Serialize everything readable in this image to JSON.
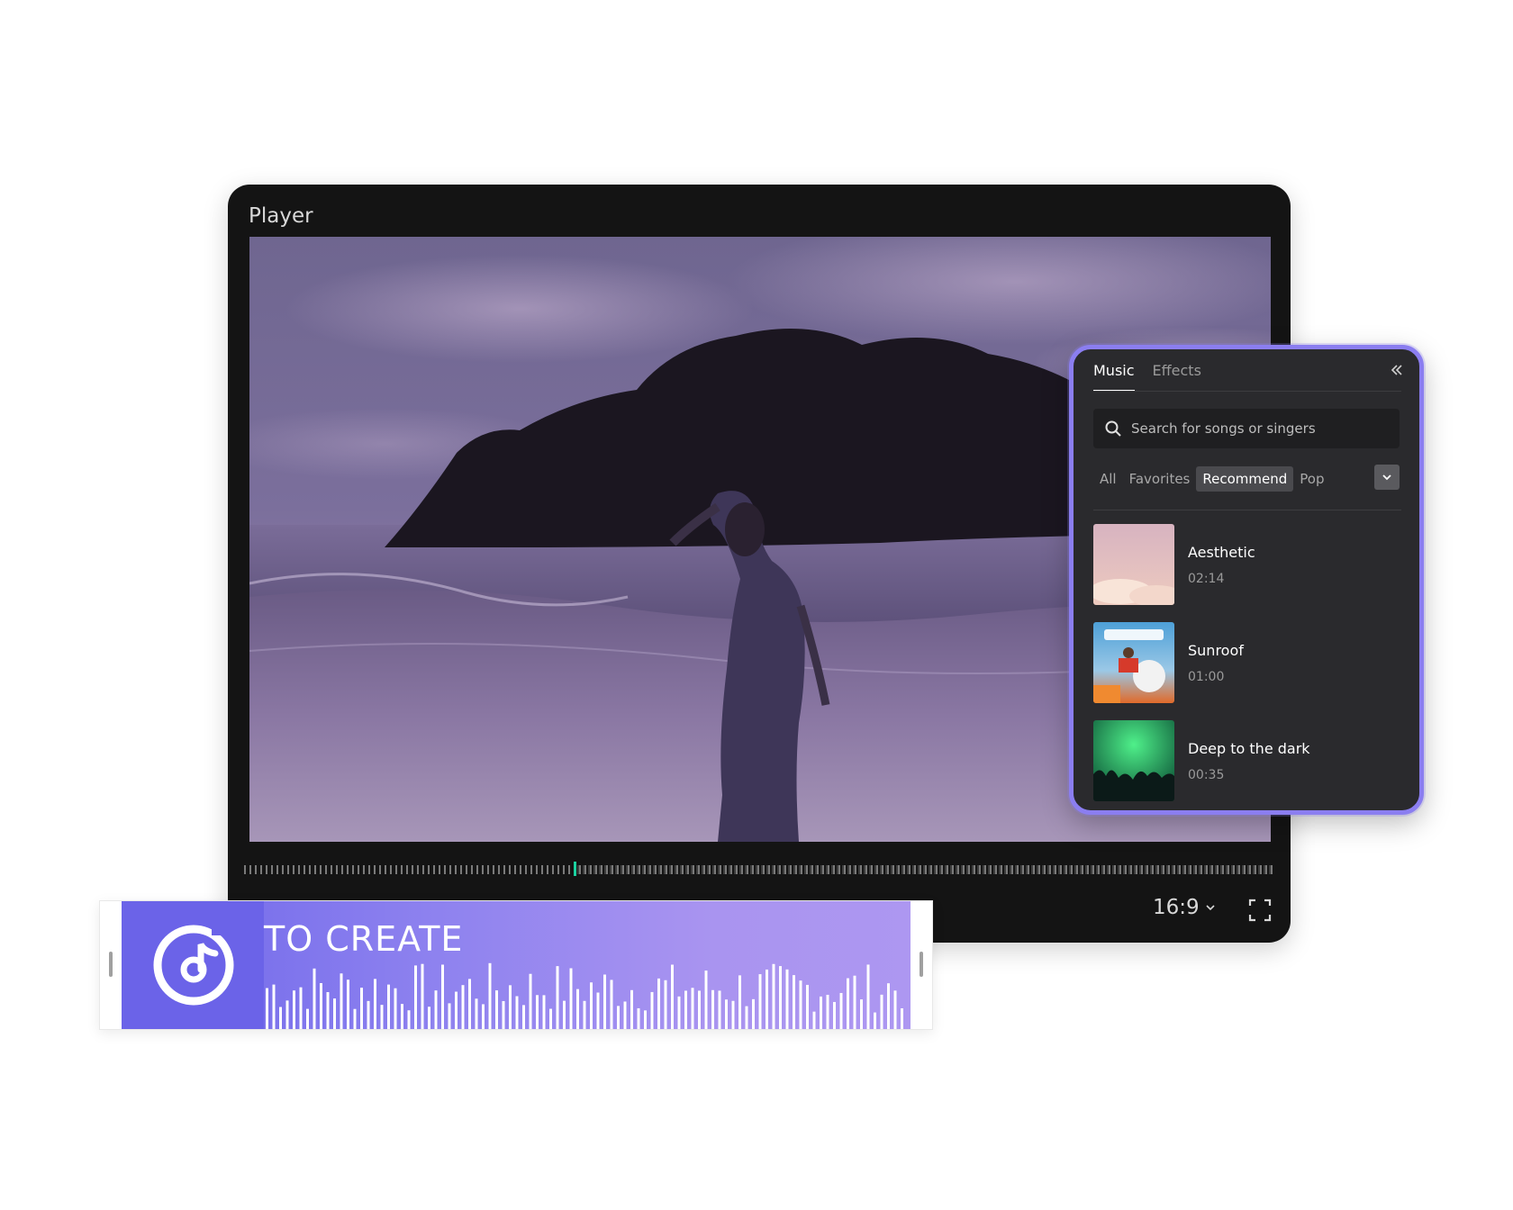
{
  "player": {
    "title": "Player",
    "playhead_progress": 0.32,
    "aspect_ratio": "16:9"
  },
  "music_panel": {
    "tabs": [
      {
        "label": "Music",
        "active": true
      },
      {
        "label": "Effects",
        "active": false
      }
    ],
    "search": {
      "placeholder": "Search for songs or singers",
      "value": ""
    },
    "filters": [
      {
        "label": "All",
        "active": false
      },
      {
        "label": "Favorites",
        "active": false
      },
      {
        "label": "Recommend",
        "active": true
      },
      {
        "label": "Pop",
        "active": false
      }
    ],
    "tracks": [
      {
        "name": "Aesthetic",
        "duration": "02:14"
      },
      {
        "name": "Sunroof",
        "duration": "01:00"
      },
      {
        "name": "Deep to the dark",
        "duration": "00:35"
      }
    ],
    "accent_color": "#8b7ef0"
  },
  "audio_clip": {
    "title": "TO CREATE",
    "colors": {
      "start": "#6e66ea",
      "end": "#ad97f1"
    }
  },
  "colors": {
    "player_bg": "#141414",
    "panel_bg": "#2a2a2d",
    "playhead": "#1bd1a0"
  }
}
